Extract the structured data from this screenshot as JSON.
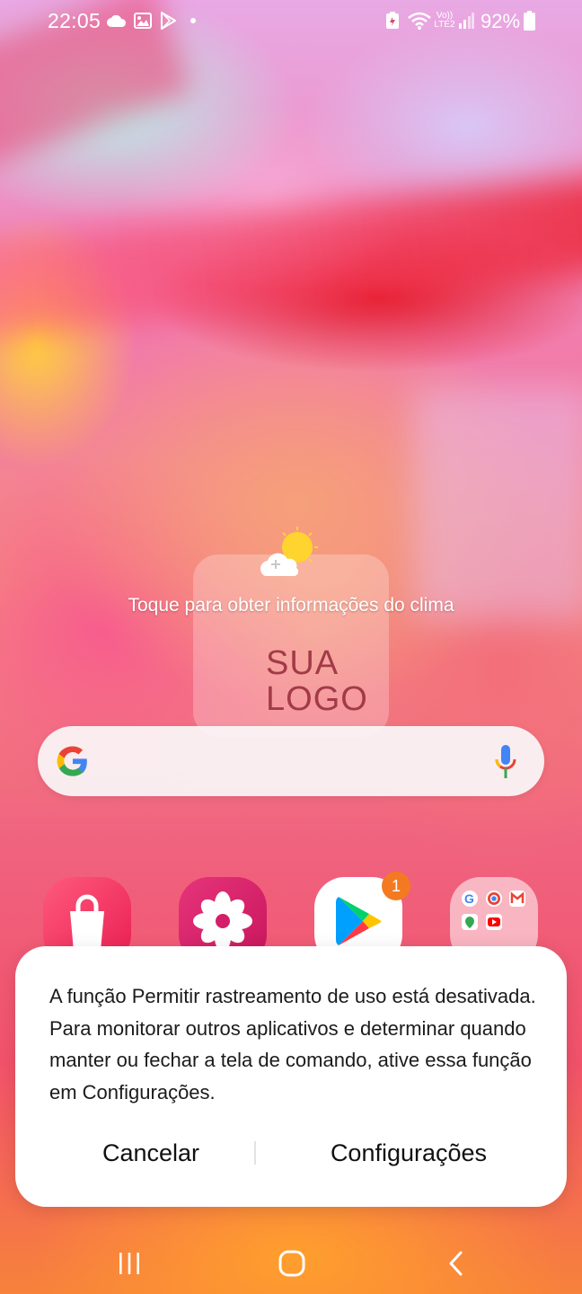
{
  "status_bar": {
    "time": "22:05",
    "battery_percent": "92%",
    "network_label": "Vo)) LTE2",
    "left_icons": [
      "cloud-icon",
      "image-icon",
      "play-store-icon",
      "dot-icon"
    ],
    "right_icons": [
      "battery-saver-icon",
      "wifi-icon",
      "volte-icon",
      "signal-icon",
      "battery-icon"
    ]
  },
  "weather_widget": {
    "message": "Toque para obter informações do clima",
    "logo_text": "SUA LOGO",
    "icon": "sun-cloud-icon"
  },
  "search_bar": {
    "left_icon": "google-icon",
    "right_icon": "microphone-icon"
  },
  "apps": [
    {
      "name": "galaxy-store",
      "icon": "shopping-bag-icon"
    },
    {
      "name": "gallery",
      "icon": "flower-icon"
    },
    {
      "name": "play-store",
      "icon": "play-store-icon",
      "badge": "1"
    },
    {
      "name": "google-folder",
      "icon": "google-apps-folder-icon"
    }
  ],
  "dialog": {
    "message": "A função Permitir rastreamento de uso está desativada. Para monitorar outros aplicativos e determinar quando manter ou fechar a tela de comando, ative essa função em Configurações.",
    "cancel_label": "Cancelar",
    "confirm_label": "Configurações"
  },
  "nav_bar": {
    "recents_icon": "recents-icon",
    "home_icon": "home-icon",
    "back_icon": "back-icon"
  },
  "colors": {
    "badge": "#f37a21",
    "logo_text": "#a23a48",
    "dialog_background": "#ffffff"
  }
}
